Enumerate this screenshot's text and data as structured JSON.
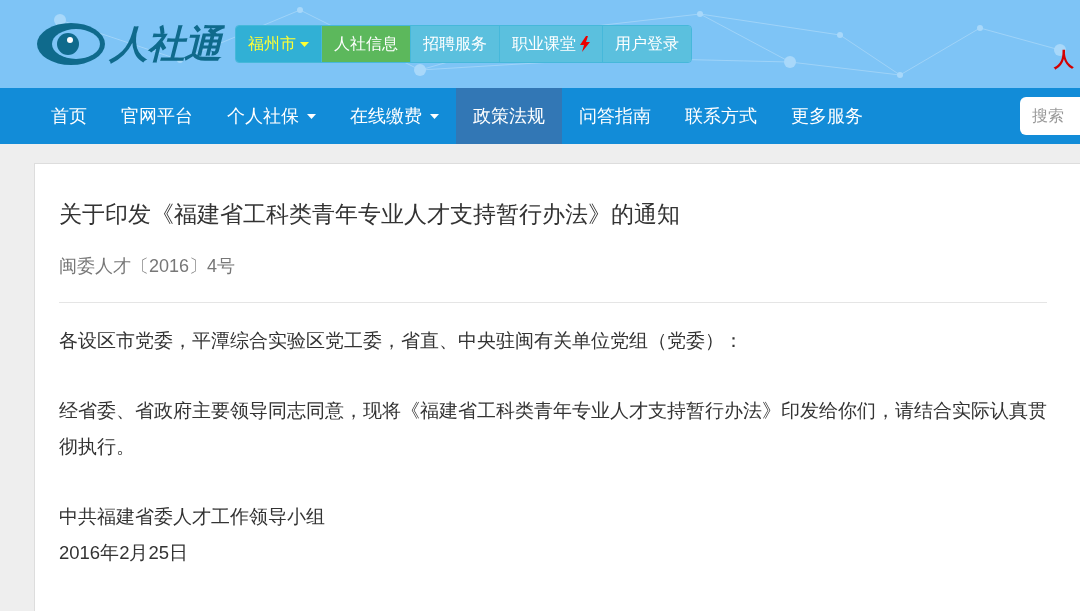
{
  "logo": {
    "text": "人社通"
  },
  "top_tabs": [
    {
      "label": "福州市",
      "kind": "city",
      "selected": false
    },
    {
      "label": "人社信息",
      "kind": "tab",
      "selected": true
    },
    {
      "label": "招聘服务",
      "kind": "tab",
      "selected": false
    },
    {
      "label": "职业课堂",
      "kind": "hot",
      "selected": false
    },
    {
      "label": "用户登录",
      "kind": "tab",
      "selected": false
    }
  ],
  "header_right_text": "人",
  "nav": [
    {
      "label": "首页",
      "dropdown": false,
      "selected": false
    },
    {
      "label": "官网平台",
      "dropdown": false,
      "selected": false
    },
    {
      "label": "个人社保",
      "dropdown": true,
      "selected": false
    },
    {
      "label": "在线缴费",
      "dropdown": true,
      "selected": false
    },
    {
      "label": "政策法规",
      "dropdown": false,
      "selected": true
    },
    {
      "label": "问答指南",
      "dropdown": false,
      "selected": false
    },
    {
      "label": "联系方式",
      "dropdown": false,
      "selected": false
    },
    {
      "label": "更多服务",
      "dropdown": false,
      "selected": false
    }
  ],
  "search": {
    "placeholder": "搜索"
  },
  "article": {
    "title": "关于印发《福建省工科类青年专业人才支持暂行办法》的通知",
    "doc_number": "闽委人才〔2016〕4号",
    "paragraphs": [
      "各设区市党委，平潭综合实验区党工委，省直、中央驻闽有关单位党组（党委）：",
      "经省委、省政府主要领导同志同意，现将《福建省工科类青年专业人才支持暂行办法》印发给你们，请结合实际认真贯彻执行。"
    ],
    "signature": [
      "中共福建省委人才工作领导小组",
      "2016年2月25日"
    ]
  }
}
